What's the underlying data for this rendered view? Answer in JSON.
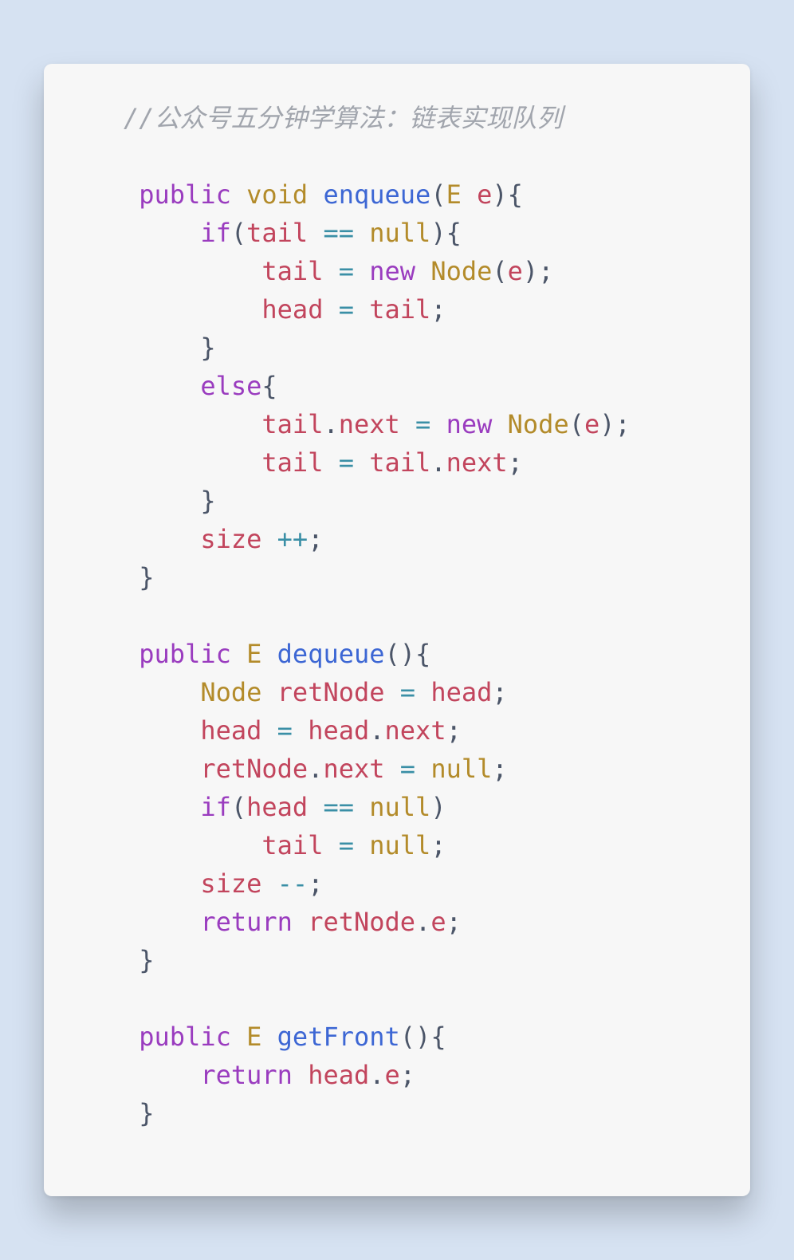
{
  "code": {
    "comment": "//公众号五分钟学算法：链表实现队列",
    "tokens": {
      "public": "public",
      "void": "void",
      "enqueue": "enqueue",
      "E": "E",
      "e": "e",
      "if": "if",
      "tail": "tail",
      "eqeq": "==",
      "null": "null",
      "assign": "=",
      "new": "new",
      "Node": "Node",
      "head": "head",
      "else": "else",
      "next": "next",
      "size": "size",
      "plusplus": "++",
      "dequeue": "dequeue",
      "retNode": "retNode",
      "minusminus": "--",
      "return": "return",
      "getFront": "getFront"
    }
  }
}
